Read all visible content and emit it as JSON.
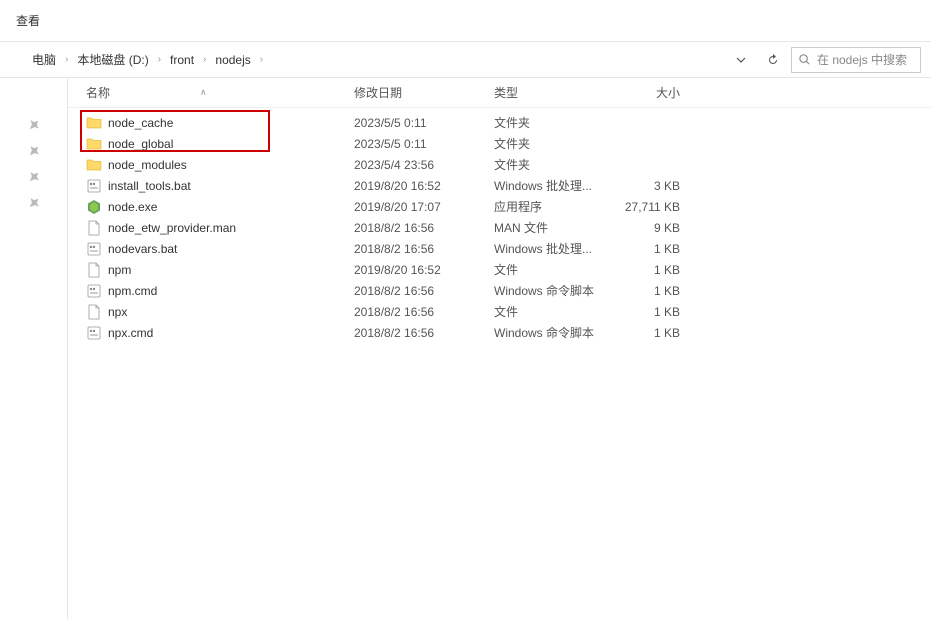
{
  "tab": {
    "label": "查看"
  },
  "breadcrumb": {
    "items": [
      "电脑",
      "本地磁盘 (D:)",
      "front",
      "nodejs"
    ]
  },
  "search": {
    "placeholder": "在 nodejs 中搜索"
  },
  "columns": {
    "name": "名称",
    "date": "修改日期",
    "type": "类型",
    "size": "大小"
  },
  "files": [
    {
      "icon": "folder",
      "name": "node_cache",
      "date": "2023/5/5 0:11",
      "type": "文件夹",
      "size": ""
    },
    {
      "icon": "folder",
      "name": "node_global",
      "date": "2023/5/5 0:11",
      "type": "文件夹",
      "size": ""
    },
    {
      "icon": "folder",
      "name": "node_modules",
      "date": "2023/5/4 23:56",
      "type": "文件夹",
      "size": ""
    },
    {
      "icon": "bat",
      "name": "install_tools.bat",
      "date": "2019/8/20 16:52",
      "type": "Windows 批处理...",
      "size": "3 KB"
    },
    {
      "icon": "node",
      "name": "node.exe",
      "date": "2019/8/20 17:07",
      "type": "应用程序",
      "size": "27,711 KB"
    },
    {
      "icon": "file",
      "name": "node_etw_provider.man",
      "date": "2018/8/2 16:56",
      "type": "MAN 文件",
      "size": "9 KB"
    },
    {
      "icon": "bat",
      "name": "nodevars.bat",
      "date": "2018/8/2 16:56",
      "type": "Windows 批处理...",
      "size": "1 KB"
    },
    {
      "icon": "file",
      "name": "npm",
      "date": "2019/8/20 16:52",
      "type": "文件",
      "size": "1 KB"
    },
    {
      "icon": "cmd",
      "name": "npm.cmd",
      "date": "2018/8/2 16:56",
      "type": "Windows 命令脚本",
      "size": "1 KB"
    },
    {
      "icon": "file",
      "name": "npx",
      "date": "2018/8/2 16:56",
      "type": "文件",
      "size": "1 KB"
    },
    {
      "icon": "cmd",
      "name": "npx.cmd",
      "date": "2018/8/2 16:56",
      "type": "Windows 命令脚本",
      "size": "1 KB"
    }
  ],
  "highlight": {
    "startIndex": 0,
    "endIndex": 1
  }
}
